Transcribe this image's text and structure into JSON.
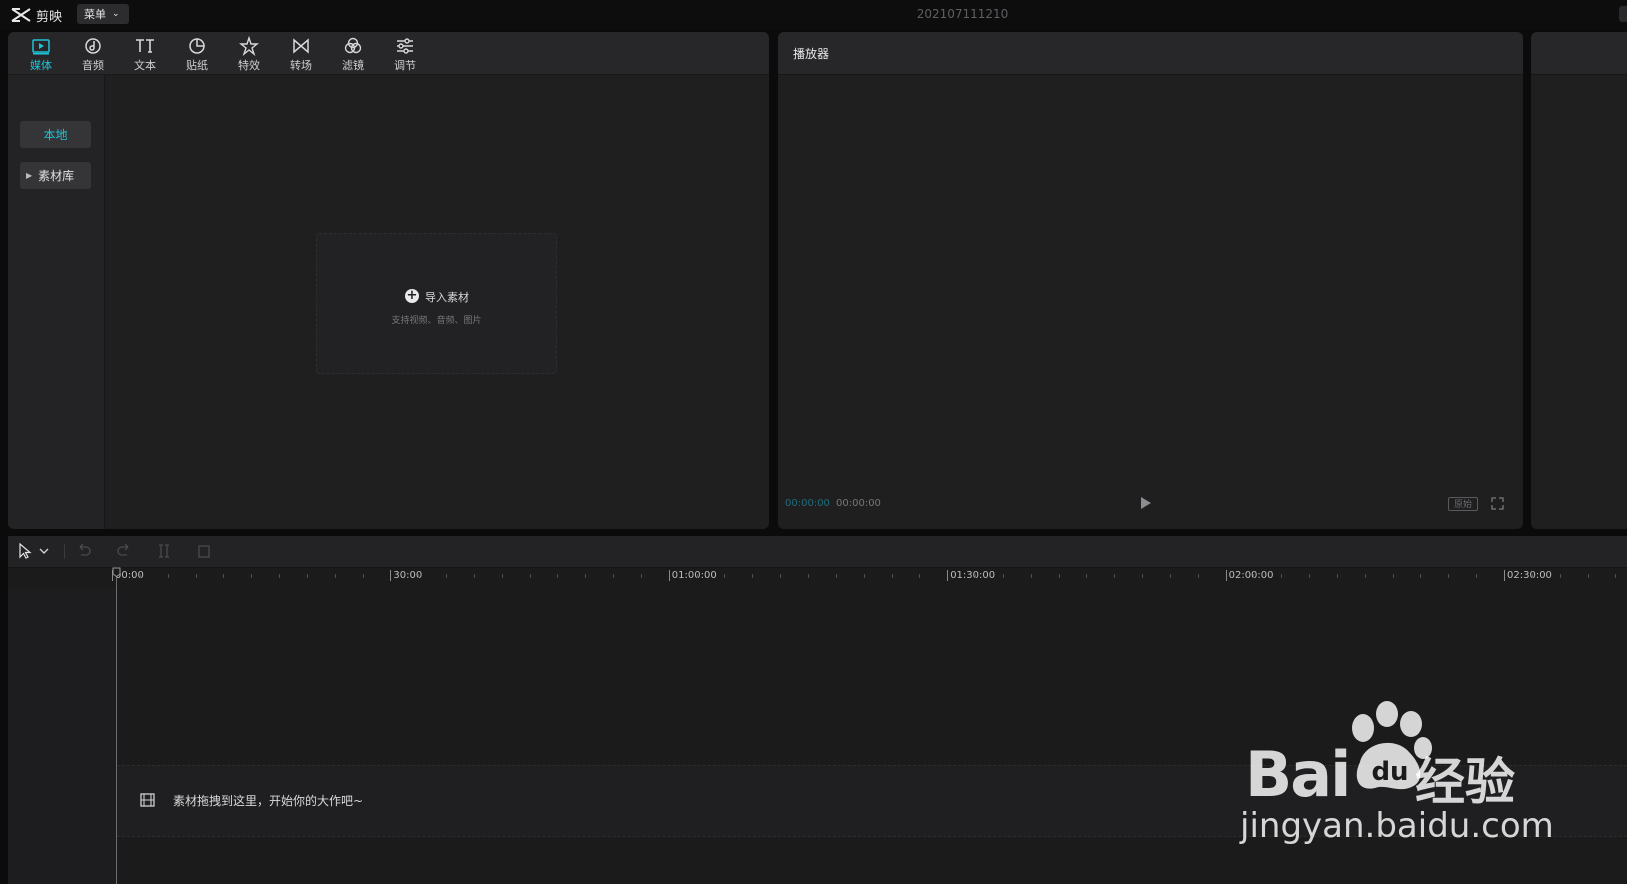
{
  "app": {
    "name": "剪映",
    "menu_label": "菜单",
    "project_title": "202107111210"
  },
  "media_toolbar": {
    "tools": [
      {
        "label": "媒体",
        "icon": "media-icon",
        "active": true
      },
      {
        "label": "音频",
        "icon": "audio-icon",
        "active": false
      },
      {
        "label": "文本",
        "icon": "text-icon",
        "active": false
      },
      {
        "label": "贴纸",
        "icon": "sticker-icon",
        "active": false
      },
      {
        "label": "特效",
        "icon": "effects-icon",
        "active": false
      },
      {
        "label": "转场",
        "icon": "transition-icon",
        "active": false
      },
      {
        "label": "滤镜",
        "icon": "filter-icon",
        "active": false
      },
      {
        "label": "调节",
        "icon": "adjust-icon",
        "active": false
      }
    ]
  },
  "media_sidebar": {
    "local_label": "本地",
    "library_label": "素材库"
  },
  "import": {
    "label": "导入素材",
    "hint": "支持视频、音频、图片"
  },
  "player": {
    "title": "播放器",
    "time_current": "00:00:00",
    "time_total": "00:00:00",
    "ratio_label": "原始"
  },
  "timeline": {
    "ruler_labels": [
      "00:00",
      "30:00",
      "01:00:00",
      "01:30:00",
      "02:00:00",
      "02:30:00"
    ],
    "track_hint": "素材拖拽到这里，开始你的大作吧~"
  },
  "watermark": {
    "brand": "Bai",
    "brand_suffix": "经验",
    "url": "jingyan.baidu.com"
  },
  "colors": {
    "accent": "#1fc4d8",
    "background": "#0b0b0c",
    "panel": "#1f1f20"
  }
}
